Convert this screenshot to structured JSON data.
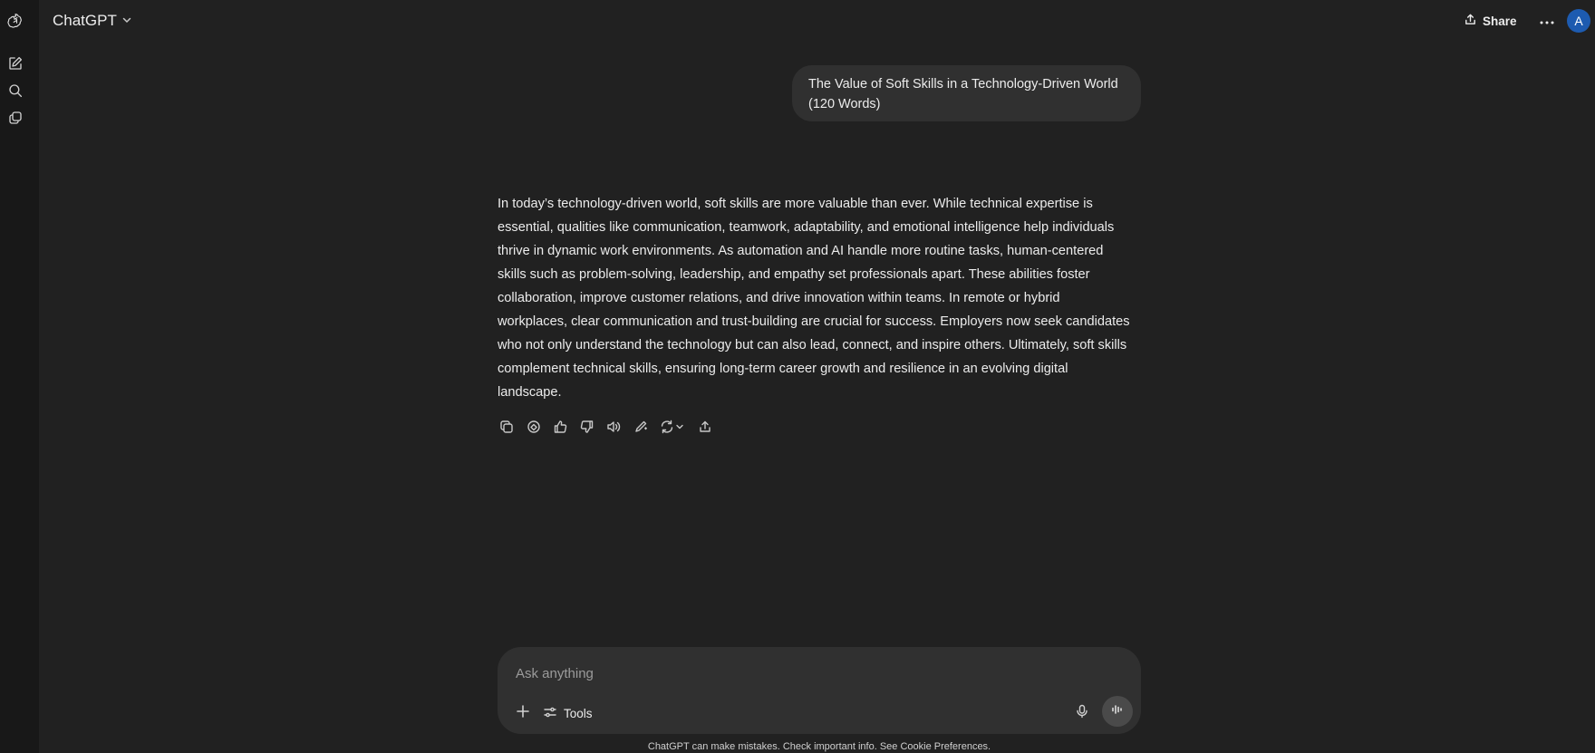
{
  "header": {
    "model_name": "ChatGPT",
    "share_label": "Share",
    "avatar_initial": "A"
  },
  "conversation": {
    "user_message": "The Value of Soft Skills in a Technology-Driven World (120 Words)",
    "assistant_lines": [
      "In today’s technology-driven world, soft skills are more valuable than ever. While technical expertise is",
      "essential, qualities like communication, teamwork, adaptability, and emotional intelligence help individuals",
      "thrive in dynamic work environments. As automation and AI handle more routine tasks, human-centered",
      "skills such as problem-solving, leadership, and empathy set professionals apart. These abilities foster",
      "collaboration, improve customer relations, and drive innovation within teams. In remote or hybrid",
      "workplaces, clear communication and trust-building are crucial for success. Employers now seek candidates",
      "who not only understand the technology but can also lead, connect, and inspire others. Ultimately, soft skills",
      "complement technical skills, ensuring long-term career growth and resilience in an evolving digital",
      "landscape."
    ]
  },
  "message_actions": [
    "copy-icon",
    "canvas-icon",
    "thumbs-up-icon",
    "thumbs-down-icon",
    "read-aloud-icon",
    "edit-icon",
    "regenerate-icon",
    "share-icon"
  ],
  "sidebar_icons": [
    "openai-logo-icon",
    "new-chat-icon",
    "search-icon",
    "library-icon"
  ],
  "composer": {
    "placeholder": "Ask anything",
    "tools_label": "Tools"
  },
  "footer": {
    "disclaimer": "ChatGPT can make mistakes. Check important info. See Cookie Preferences."
  },
  "colors": {
    "background": "#212121",
    "rail": "#181818",
    "bubble": "#303030",
    "avatar": "#1d5bb0"
  }
}
